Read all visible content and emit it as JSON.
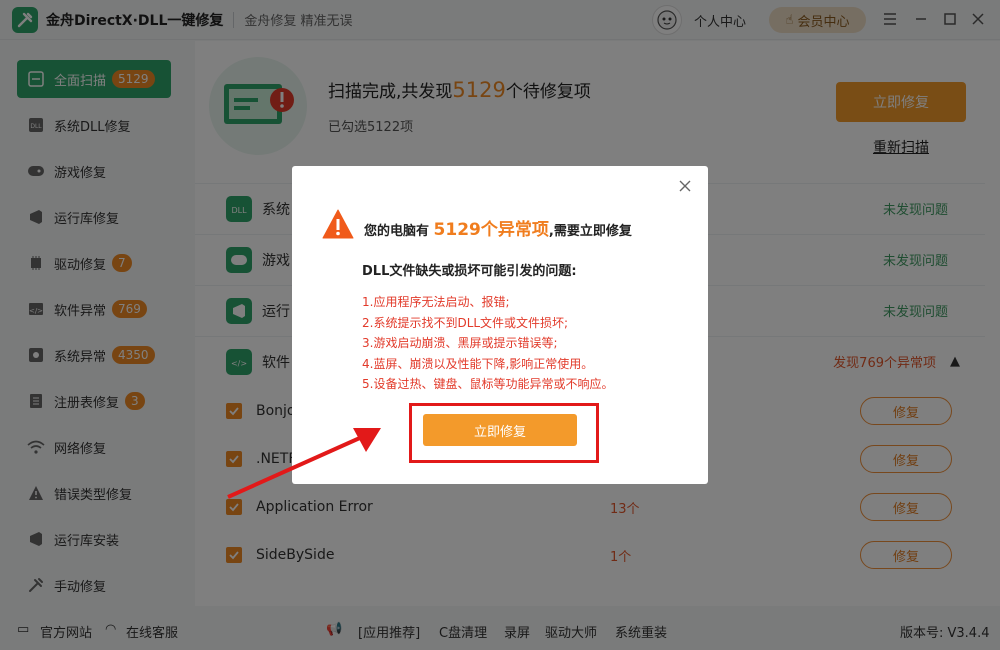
{
  "titlebar": {
    "app_title": "金舟DirectX·DLL一键修复",
    "slogan": "金舟修复 精准无误",
    "personal_center": "个人中心",
    "vip_center": "会员中心"
  },
  "sidebar": {
    "items": [
      {
        "label": "全面扫描",
        "badge": "5129"
      },
      {
        "label": "系统DLL修复",
        "badge": ""
      },
      {
        "label": "游戏修复",
        "badge": ""
      },
      {
        "label": "运行库修复",
        "badge": ""
      },
      {
        "label": "驱动修复",
        "badge": "7"
      },
      {
        "label": "软件异常",
        "badge": "769"
      },
      {
        "label": "系统异常",
        "badge": "4350"
      },
      {
        "label": "注册表修复",
        "badge": "3"
      },
      {
        "label": "网络修复",
        "badge": ""
      },
      {
        "label": "错误类型修复",
        "badge": ""
      },
      {
        "label": "运行库安装",
        "badge": ""
      },
      {
        "label": "手动修复",
        "badge": ""
      }
    ]
  },
  "scan": {
    "title_prefix": "扫描完成,共发现",
    "count": "5129",
    "title_suffix": "个待修复项",
    "selected": "已勾选5122项",
    "fix_now": "立即修复",
    "rescan": "重新扫描"
  },
  "categories": [
    {
      "name": "系统",
      "status": "未发现问题"
    },
    {
      "name": "游戏",
      "status": "未发现问题"
    },
    {
      "name": "运行",
      "status": "未发现问题"
    },
    {
      "name": "软件",
      "status": "发现769个异常项"
    }
  ],
  "items": [
    {
      "name": "Bonjo",
      "count": "",
      "action": "修复"
    },
    {
      "name": ".NETF",
      "count": "",
      "action": "修复"
    },
    {
      "name": "Application Error",
      "count": "13个",
      "action": "修复"
    },
    {
      "name": "SideBySide",
      "count": "1个",
      "action": "修复"
    }
  ],
  "footer": {
    "website": "官方网站",
    "service": "在线客服",
    "recommend": "[应用推荐]",
    "links": [
      "C盘清理",
      "录屏",
      "驱动大师",
      "系统重装"
    ],
    "version": "版本号: V3.4.4"
  },
  "modal": {
    "warn_prefix": "您的电脑有",
    "warn_highlight": "5129个异常项",
    "warn_suffix": ",需要立即修复",
    "problem_head": "DLL文件缺失或损坏可能引发的问题:",
    "problems": [
      "1.应用程序无法启动、报错;",
      "2.系统提示找不到DLL文件或文件损坏;",
      "3.游戏启动崩溃、黑屏或提示错误等;",
      "4.蓝屏、崩溃以及性能下降,影响正常使用。",
      "5.设备过热、键盘、鼠标等功能异常或不响应。"
    ],
    "fix_button": "立即修复"
  },
  "colors": {
    "brand_green": "#2fa46a",
    "accent_orange": "#f39a2b",
    "warn_red": "#e23a2a",
    "annotation_red": "#e21919"
  }
}
